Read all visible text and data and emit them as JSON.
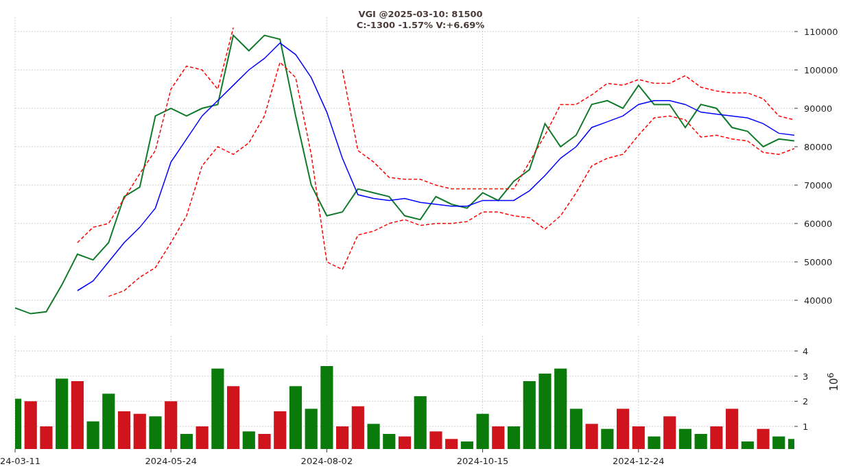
{
  "header": {
    "title": "VGI @2025-03-10: 81500",
    "stats": "C:-1300 -1.57% V:+6.69%"
  },
  "price": {
    "chart_data": {
      "type": "line",
      "grid": true,
      "categories": [
        null,
        null,
        null,
        null,
        null,
        null,
        null,
        null,
        null,
        null,
        null,
        null,
        null,
        null,
        null,
        null,
        null,
        null,
        null,
        null,
        null,
        null,
        null,
        null,
        null,
        null,
        null,
        null,
        null,
        null,
        null,
        null,
        null,
        null,
        null,
        null,
        null,
        null,
        null,
        null,
        null,
        null,
        null,
        null,
        null,
        null,
        null,
        null,
        null,
        null,
        null
      ],
      "ylim": [
        33400,
        113750
      ],
      "yticks": [
        40000,
        50000,
        60000,
        70000,
        80000,
        90000,
        100000,
        110000
      ],
      "series": [
        {
          "color": "#117a2a",
          "line_style": "solid",
          "values": [
            38000,
            36500,
            37000,
            44000,
            52000,
            50500,
            55000,
            67000,
            69500,
            88000,
            90000,
            88000,
            90000,
            91000,
            109000,
            105000,
            109000,
            108000,
            88000,
            70000,
            62000,
            63000,
            69000,
            68000,
            67000,
            62000,
            61000,
            67000,
            65000,
            64000,
            68000,
            66000,
            71000,
            74000,
            86000,
            80000,
            83000,
            91000,
            92000,
            90000,
            96000,
            91000,
            91000,
            85000,
            91000,
            90000,
            85000,
            84000,
            80000,
            82000,
            81500
          ]
        },
        {
          "color": "#0000ff",
          "line_style": "solid",
          "values": [
            null,
            null,
            null,
            null,
            42500,
            45000,
            50000,
            55000,
            59000,
            64000,
            76000,
            82000,
            88000,
            92000,
            96000,
            100000,
            103000,
            107000,
            104000,
            98000,
            89000,
            77000,
            67500,
            66500,
            66000,
            66500,
            65500,
            65000,
            64500,
            64500,
            66000,
            66000,
            66000,
            68500,
            72500,
            77000,
            80000,
            85000,
            86500,
            88000,
            91000,
            92000,
            92000,
            91000,
            89000,
            88500,
            88000,
            87500,
            86000,
            83500,
            83000
          ]
        },
        {
          "color": "#ff0000",
          "line_style": "dashed",
          "values": [
            null,
            null,
            null,
            null,
            55000,
            59000,
            60000,
            66500,
            73000,
            79000,
            95000,
            101000,
            100000,
            95000,
            111000,
            null,
            null,
            null,
            null,
            null,
            null,
            100000,
            79000,
            76000,
            72000,
            71500,
            71500,
            70000,
            69000,
            69000,
            69000,
            69000,
            69000,
            76000,
            83000,
            91000,
            91000,
            93500,
            96500,
            96000,
            97500,
            96500,
            96500,
            98500,
            95500,
            94500,
            94000,
            94000,
            92500,
            88000,
            87000
          ]
        },
        {
          "color": "#ff0000",
          "line_style": "dashed",
          "values": [
            null,
            null,
            null,
            null,
            null,
            null,
            41000,
            42500,
            46000,
            48500,
            55000,
            62000,
            75000,
            80000,
            78000,
            81000,
            88000,
            102000,
            98000,
            78000,
            50000,
            48000,
            57000,
            58000,
            60000,
            61000,
            59500,
            60000,
            60000,
            60500,
            63000,
            63000,
            62000,
            61500,
            58500,
            62000,
            68000,
            75000,
            77000,
            78000,
            83000,
            87500,
            88000,
            87000,
            82500,
            83000,
            82000,
            81500,
            78500,
            78000,
            79500
          ]
        }
      ]
    }
  },
  "volume": {
    "chart_data": {
      "type": "bar",
      "grid": true,
      "ylabel": "10$^{6}$",
      "categories": [
        "24-03-11",
        null,
        null,
        null,
        null,
        null,
        null,
        null,
        null,
        null,
        "2024-05-24",
        null,
        null,
        null,
        null,
        null,
        null,
        null,
        null,
        null,
        "2024-08-02",
        null,
        null,
        null,
        null,
        null,
        null,
        null,
        null,
        null,
        "2024-10-15",
        null,
        null,
        null,
        null,
        null,
        null,
        null,
        null,
        null,
        "2024-12-24",
        null,
        null,
        null,
        null,
        null,
        null,
        null,
        null,
        null,
        null
      ],
      "ylim": [
        0.1,
        4.6
      ],
      "yticks": [
        1,
        2,
        3,
        4
      ],
      "series": [
        {
          "color": "#0a7a0a",
          "values": [
            2.1,
            null,
            null,
            2.9,
            null,
            1.2,
            2.3,
            null,
            null,
            1.4,
            null,
            0.7,
            null,
            3.3,
            null,
            0.8,
            null,
            null,
            2.6,
            1.7,
            3.4,
            null,
            null,
            1.1,
            0.7,
            null,
            2.2,
            null,
            null,
            0.4,
            1.5,
            null,
            1.0,
            2.8,
            3.1,
            3.3,
            1.7,
            null,
            0.9,
            null,
            null,
            0.6,
            null,
            0.9,
            0.7,
            null,
            null,
            0.4,
            null,
            0.6,
            0.5
          ]
        },
        {
          "color": "#d0141e",
          "values": [
            null,
            2.0,
            1.0,
            null,
            2.8,
            null,
            null,
            1.6,
            1.5,
            null,
            2.0,
            null,
            1.0,
            null,
            2.6,
            null,
            0.7,
            1.6,
            null,
            null,
            null,
            1.0,
            1.8,
            null,
            null,
            0.6,
            null,
            0.8,
            0.5,
            null,
            null,
            1.0,
            null,
            null,
            null,
            null,
            null,
            1.1,
            null,
            1.7,
            1.0,
            null,
            1.4,
            null,
            null,
            1.0,
            1.7,
            null,
            0.9,
            null,
            null
          ]
        }
      ]
    }
  }
}
